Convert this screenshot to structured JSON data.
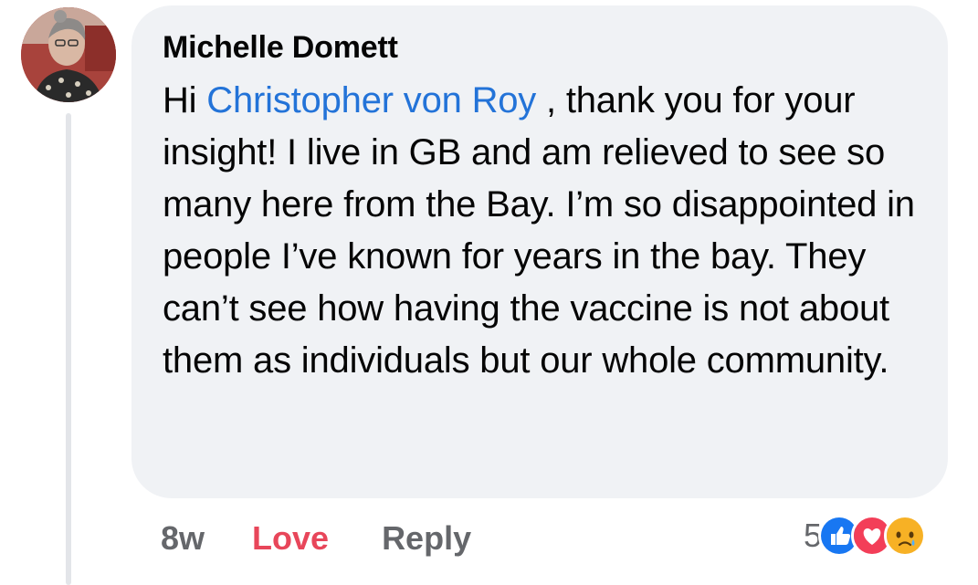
{
  "comment": {
    "author": "Michelle Domett",
    "greeting": "Hi ",
    "mention": "Christopher von Roy",
    "body": " , thank you for your insight! I live in GB and am relieved to see so many here from the Bay. I’m so disappointed in people I’ve known for years in the bay. They can’t see how having the vaccine is not about them as individuals but our whole community."
  },
  "actions": {
    "time": "8w",
    "love": "Love",
    "reply": "Reply"
  },
  "reactions": {
    "count": "5",
    "icons": [
      "like-icon",
      "heart-icon",
      "sad-icon"
    ]
  },
  "colors": {
    "bubble": "#f0f2f5",
    "mention": "#2373d8",
    "love": "#e8465a",
    "muted": "#65676b"
  }
}
